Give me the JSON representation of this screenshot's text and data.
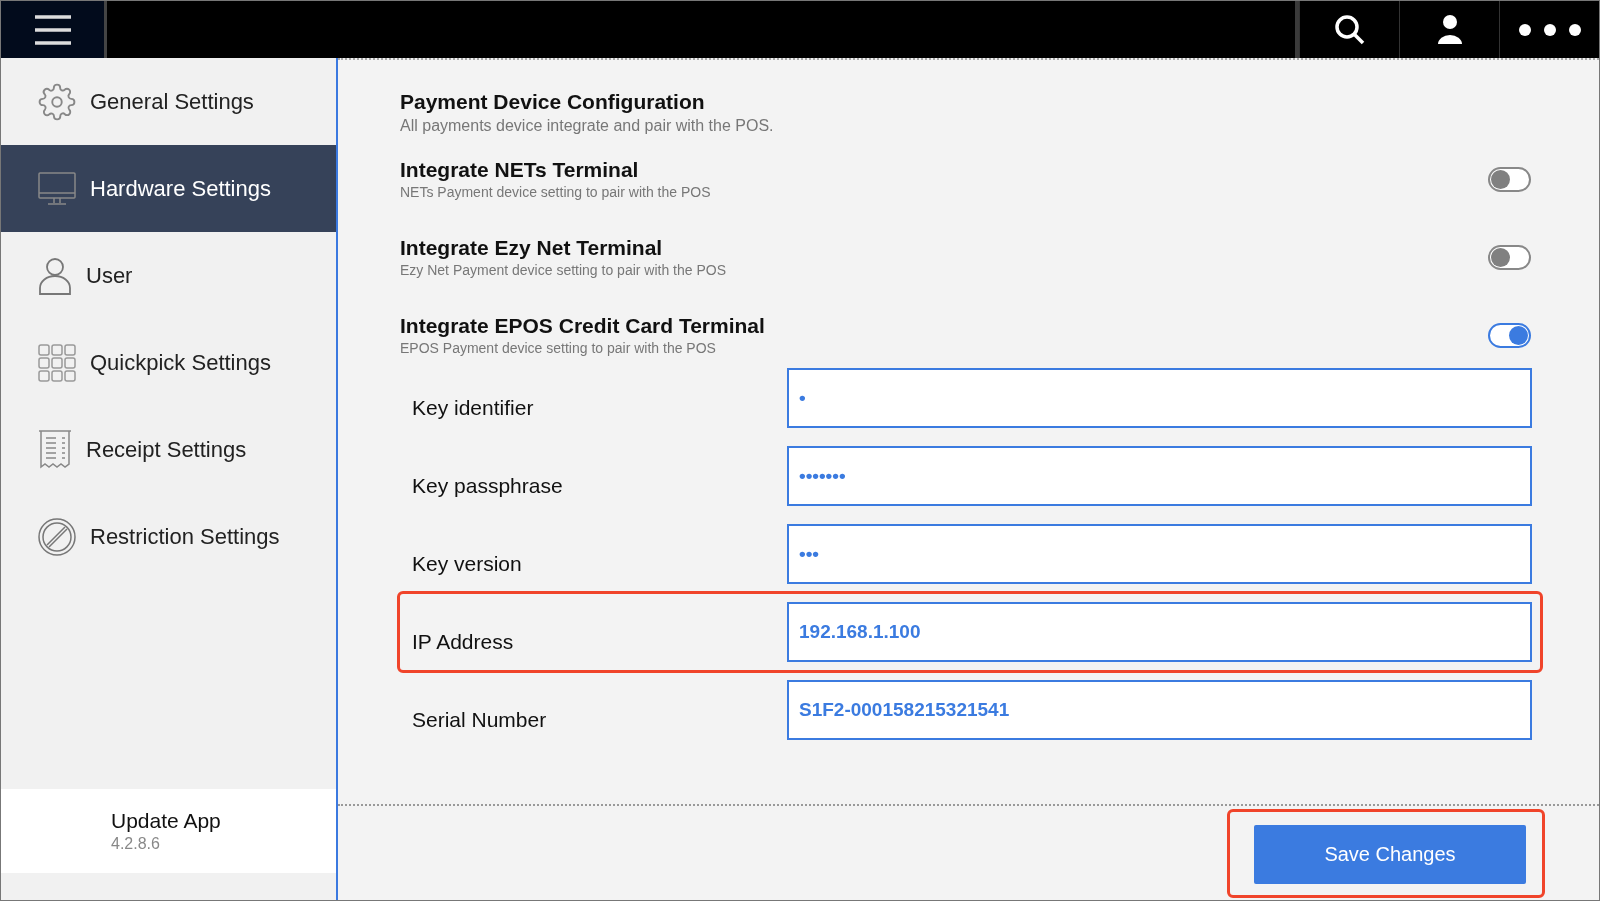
{
  "sidebar": {
    "items": [
      {
        "label": "General Settings",
        "selected": false
      },
      {
        "label": "Hardware Settings",
        "selected": true
      },
      {
        "label": "User",
        "selected": false
      },
      {
        "label": "Quickpick Settings",
        "selected": false
      },
      {
        "label": "Receipt Settings",
        "selected": false
      },
      {
        "label": "Restriction Settings",
        "selected": false
      }
    ],
    "update": {
      "title": "Update App",
      "version": "4.2.8.6"
    }
  },
  "section": {
    "title": "Payment Device Configuration",
    "subtitle": "All payments device integrate and pair with the POS."
  },
  "toggles": [
    {
      "title": "Integrate NETs Terminal",
      "subtitle": "NETs Payment device setting to pair with the POS",
      "on": false
    },
    {
      "title": "Integrate Ezy Net Terminal",
      "subtitle": "Ezy Net Payment device setting to pair with the POS",
      "on": false
    },
    {
      "title": "Integrate EPOS Credit Card Terminal",
      "subtitle": "EPOS Payment device setting to pair with the POS",
      "on": true
    }
  ],
  "fields": [
    {
      "label": "Key identifier",
      "value": "•"
    },
    {
      "label": "Key passphrase",
      "value": "•••••••"
    },
    {
      "label": "Key version",
      "value": "•••"
    },
    {
      "label": "IP Address",
      "value": "192.168.1.100",
      "highlighted": true
    },
    {
      "label": "Serial Number",
      "value": "S1F2-000158215321541"
    }
  ],
  "save_button": {
    "label": "Save Changes",
    "highlighted": true
  }
}
